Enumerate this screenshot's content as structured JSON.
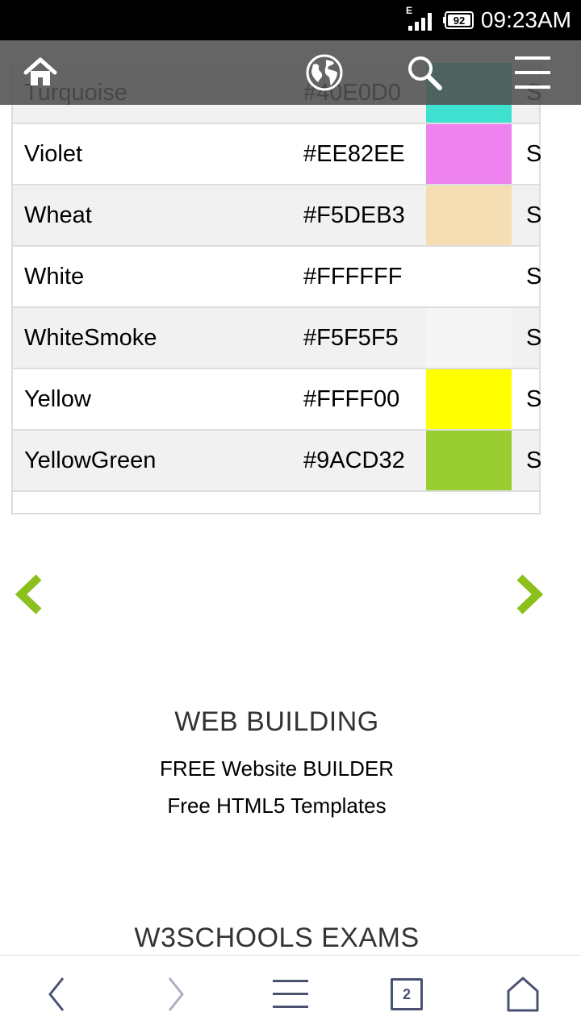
{
  "status": {
    "network": "E",
    "battery": "92",
    "time": "09:23AM"
  },
  "top_nav": {
    "home_icon": "home-icon",
    "globe_icon": "globe-icon",
    "search_icon": "search-icon",
    "menu_icon": "hamburger-menu-icon"
  },
  "partial_row": {
    "name": "Turquoise",
    "hex": "#40E0D0",
    "color": "#40E0D0",
    "s": "S"
  },
  "rows": [
    {
      "name": "Violet",
      "hex": "#EE82EE",
      "color": "#EE82EE",
      "s": "S"
    },
    {
      "name": "Wheat",
      "hex": "#F5DEB3",
      "color": "#F5DEB3",
      "s": "S"
    },
    {
      "name": "White",
      "hex": "#FFFFFF",
      "color": "#FFFFFF",
      "s": "S"
    },
    {
      "name": "WhiteSmoke",
      "hex": "#F5F5F5",
      "color": "#F5F5F5",
      "s": "S"
    },
    {
      "name": "Yellow",
      "hex": "#FFFF00",
      "color": "#FFFF00",
      "s": "S"
    },
    {
      "name": "YellowGreen",
      "hex": "#9ACD32",
      "color": "#9ACD32",
      "s": "S"
    }
  ],
  "pager": {
    "prev_icon": "chevron-left-icon",
    "next_icon": "chevron-right-icon",
    "accent": "#8cc01c"
  },
  "web_building": {
    "heading": "WEB BUILDING",
    "links": [
      "FREE Website BUILDER",
      "Free HTML5 Templates"
    ]
  },
  "exams": {
    "heading": "W3SCHOOLS EXAMS"
  },
  "browser_bar": {
    "tab_count": "2",
    "icon_color": "#4a5272"
  }
}
